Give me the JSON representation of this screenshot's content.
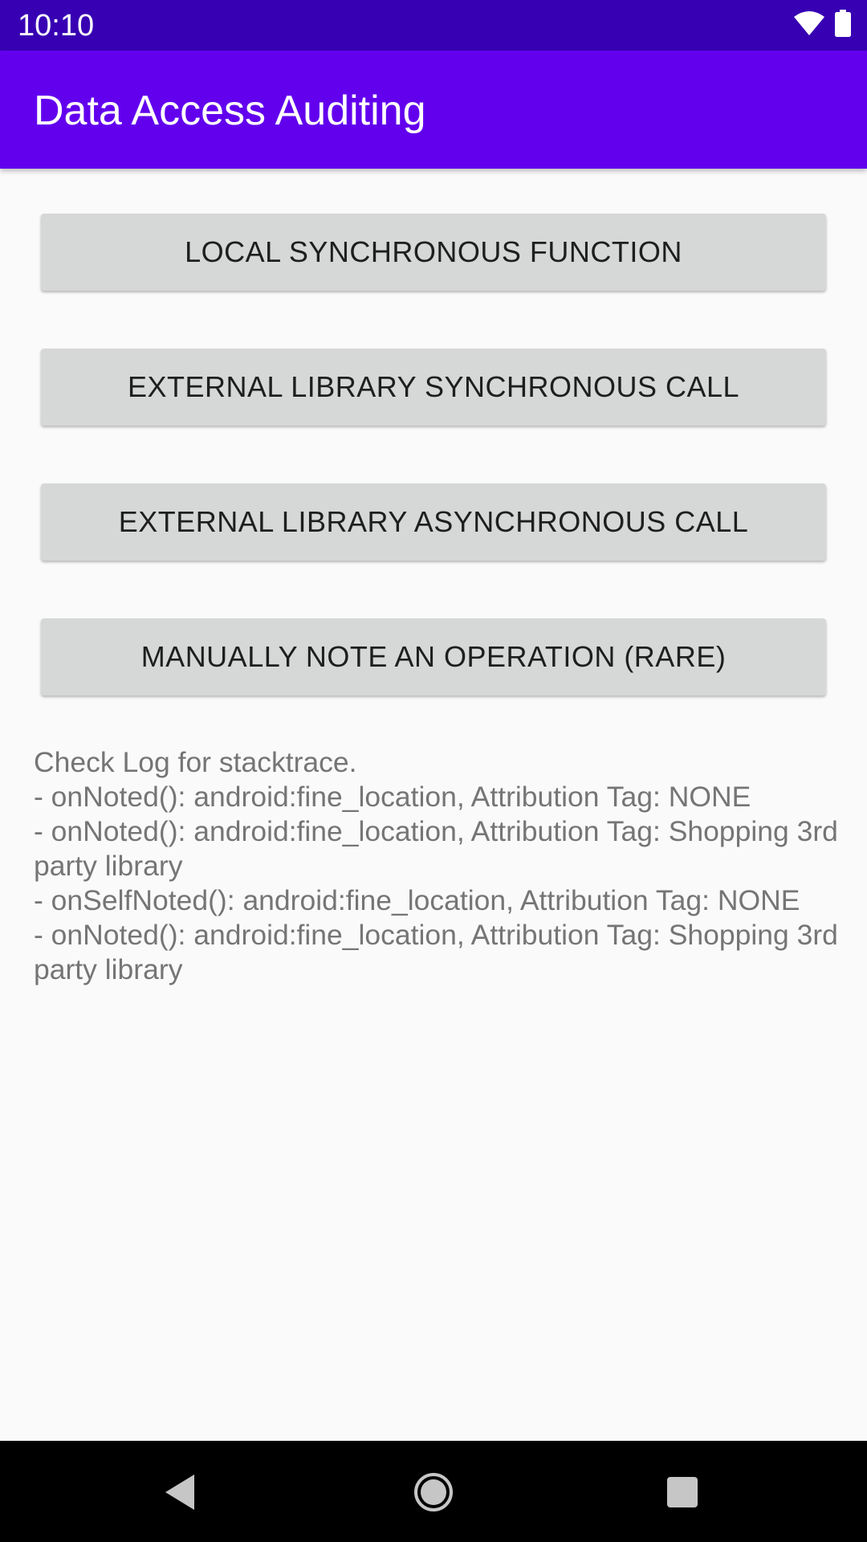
{
  "status_bar": {
    "time": "10:10",
    "icons": [
      "wifi-icon",
      "battery-icon"
    ]
  },
  "app_bar": {
    "title": "Data Access Auditing"
  },
  "buttons": [
    {
      "label": "LOCAL SYNCHRONOUS FUNCTION"
    },
    {
      "label": "EXTERNAL LIBRARY SYNCHRONOUS CALL"
    },
    {
      "label": "EXTERNAL LIBRARY ASYNCHRONOUS CALL"
    },
    {
      "label": "MANUALLY NOTE AN OPERATION (RARE)"
    }
  ],
  "log": {
    "lines": [
      "Check Log for stacktrace.",
      "- onNoted(): android:fine_location, Attribution Tag: NONE",
      "- onNoted(): android:fine_location, Attribution Tag: Shopping 3rd party library",
      "- onSelfNoted(): android:fine_location, Attribution Tag: NONE",
      "- onNoted(): android:fine_location, Attribution Tag: Shopping 3rd party library"
    ]
  },
  "nav_bar": {
    "icons": [
      "back-icon",
      "home-icon",
      "recents-icon"
    ]
  },
  "colors": {
    "status_bar": "#3700b3",
    "app_bar": "#6200ee",
    "button_bg": "#d6d7d7",
    "background": "#fafafa",
    "log_text": "#757575"
  }
}
